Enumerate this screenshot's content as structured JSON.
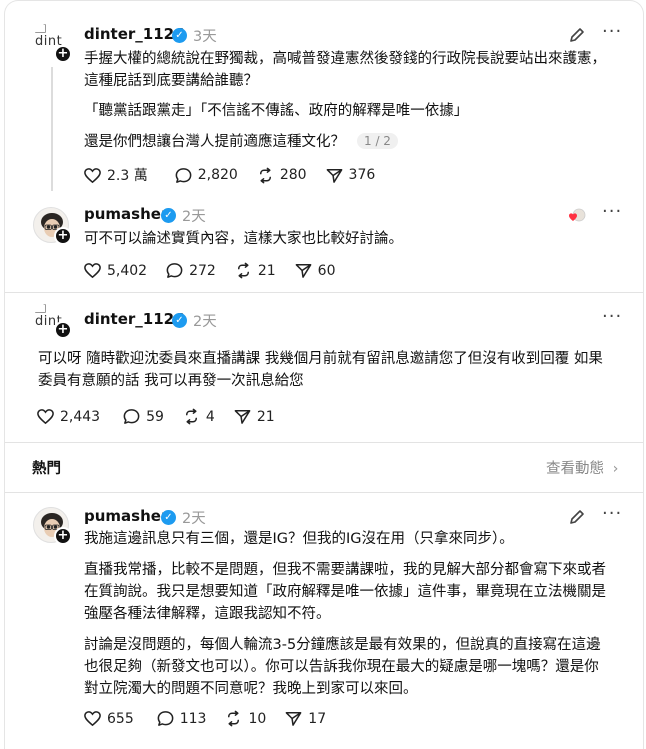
{
  "posts": [
    {
      "username": "dinter_1126",
      "time": "3天",
      "avatar_alt": "dint",
      "paragraphs": [
        "手握大權的總統說在野獨裁，高喊普發違憲然後發錢的行政院長說要站出來護憲，\n這種屁話到底要講給誰聽？",
        "「聽黨話跟黨走」「不信謠不傳謠、政府的解釋是唯一依據」",
        "還是你們想讓台灣人提前適應這種文化？"
      ],
      "pager": "1 / 2",
      "likes": "2.3 萬",
      "replies": "2,820",
      "reposts": "280",
      "shares": "376"
    },
    {
      "username": "pumashen",
      "time": "2天",
      "paragraphs": [
        "可不可以論述實質內容，這樣大家也比較好討論。"
      ],
      "likes": "5,402",
      "replies": "272",
      "reposts": "21",
      "shares": "60"
    },
    {
      "username": "dinter_1126",
      "time": "2天",
      "avatar_alt": "dint",
      "paragraphs": [
        "可以呀 隨時歡迎沈委員來直播講課 我幾個月前就有留訊息邀請您了但沒有收到回覆 如果\n委員有意願的話 我可以再發一次訊息給您"
      ],
      "likes": "2,443",
      "replies": "59",
      "reposts": "4",
      "shares": "21"
    },
    {
      "username": "pumashen",
      "time": "2天",
      "paragraphs": [
        "我施這邊訊息只有三個，還是IG？但我的IG沒在用（只拿來同步）。",
        "直播我常播，比較不是問題，但我不需要講課啦，我的見解大部分都會寫下來或者\n在質詢說。我只是想要知道「政府解釋是唯一依據」這件事，畢竟現在立法機關是\n強壓各種法律解釋，這跟我認知不符。",
        "討論是沒問題的，每個人輪流3-5分鐘應該是最有效果的，但說真的直接寫在這邊\n也很足夠（新發文也可以）。你可以告訴我你現在最大的疑慮是哪一塊嗎？還是你\n對立院濁大的問題不同意呢？我晚上到家可以來回。"
      ],
      "likes": "655",
      "replies": "113",
      "reposts": "10",
      "shares": "17"
    }
  ],
  "hot_section": {
    "label": "熱門",
    "activity_link": "查看動態"
  },
  "colors": {
    "verified": "#1d9bf0",
    "muted": "#999999",
    "divider": "#e3e3e3"
  }
}
